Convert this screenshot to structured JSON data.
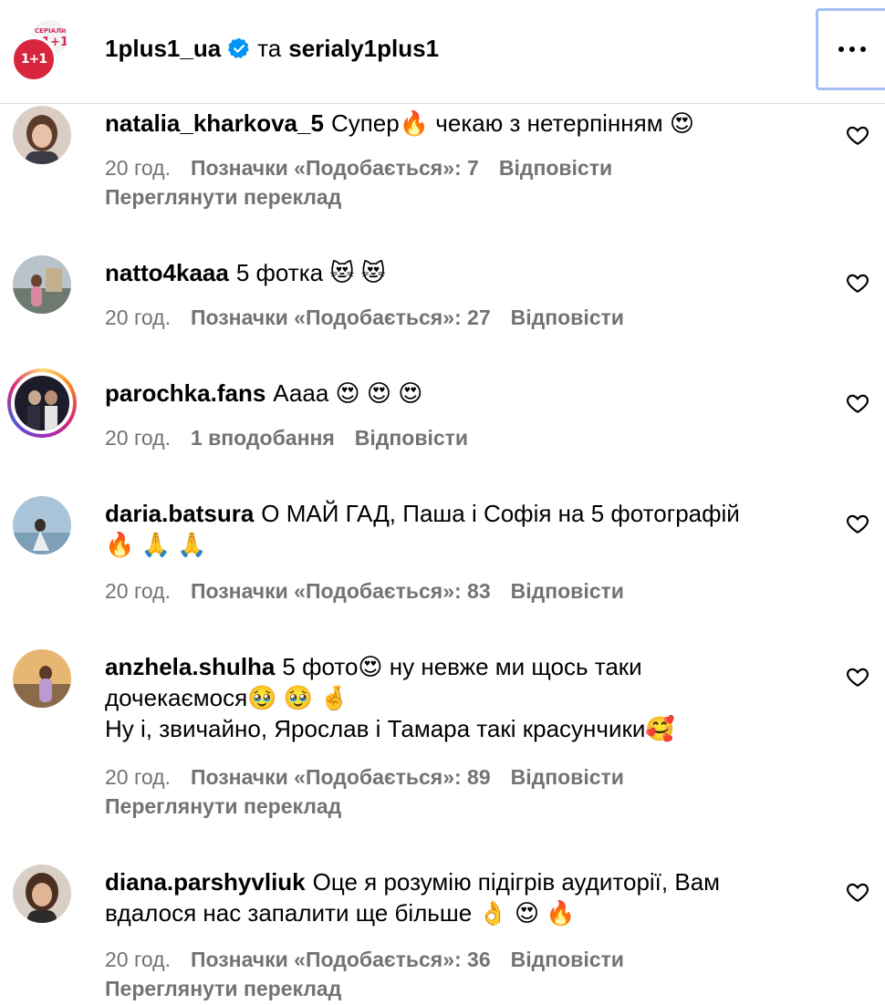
{
  "header": {
    "account": "1plus1_ua",
    "conjunction": "та",
    "collab": "serialy1plus1",
    "badge_text": "СЕРІАЛИ",
    "badge_logo": "1+1",
    "logo_text": "1+1"
  },
  "comments": [
    {
      "username": "natalia_kharkova_5",
      "lines": [
        "Супер🔥  чекаю з нетерпінням 😍"
      ],
      "time": "20 год.",
      "likes": "Позначки «Подобається»: 7",
      "reply": "Відповісти",
      "translate": "Переглянути переклад",
      "avatar_color": "#8a6a55"
    },
    {
      "username": "natto4kaaa",
      "lines": [
        "5 фотка 😻 😻"
      ],
      "time": "20 год.",
      "likes": "Позначки «Подобається»: 27",
      "reply": "Відповісти",
      "translate": "",
      "avatar_color": "#9aa39b"
    },
    {
      "username": "parochka.fans",
      "lines": [
        "Аааа 😍 😍 😍"
      ],
      "time": "20 год.",
      "likes": "1 вподобання",
      "reply": "Відповісти",
      "translate": "",
      "avatar_color": "#1c1c2a"
    },
    {
      "username": "daria.batsura",
      "lines": [
        "О МАЙ ГАД, Паша і Софія на 5 фотографій",
        "🔥 🙏 🙏"
      ],
      "time": "20 год.",
      "likes": "Позначки «Подобається»: 83",
      "reply": "Відповісти",
      "translate": "",
      "avatar_color": "#8fb0c6"
    },
    {
      "username": "anzhela.shulha",
      "lines": [
        "5 фото😍  ну невже ми щось таки",
        "дочекаємося🥹 🥹 🤞",
        "Ну і, звичайно, Ярослав і Тамара такі красунчики🥰"
      ],
      "time": "20 год.",
      "likes": "Позначки «Подобається»: 89",
      "reply": "Відповісти",
      "translate": "Переглянути переклад",
      "avatar_color": "#d99a5a"
    },
    {
      "username": "diana.parshyvliuk",
      "lines": [
        "Оце я розумію підігрів аудиторії, Вам",
        "вдалося нас запалити ще більше 👌 😍 🔥"
      ],
      "time": "20 год.",
      "likes": "Позначки «Подобається»: 36",
      "reply": "Відповісти",
      "translate": "Переглянути переклад",
      "avatar_color": "#6b4a3a"
    }
  ],
  "colors": {
    "muted": "#737373",
    "verified": "#0095f6",
    "brand_red": "#d7263d",
    "focus_ring": "#a3c0f5"
  },
  "icons": {
    "verified": "verified-badge-icon",
    "more": "more-options-icon",
    "like": "heart-outline-icon"
  }
}
